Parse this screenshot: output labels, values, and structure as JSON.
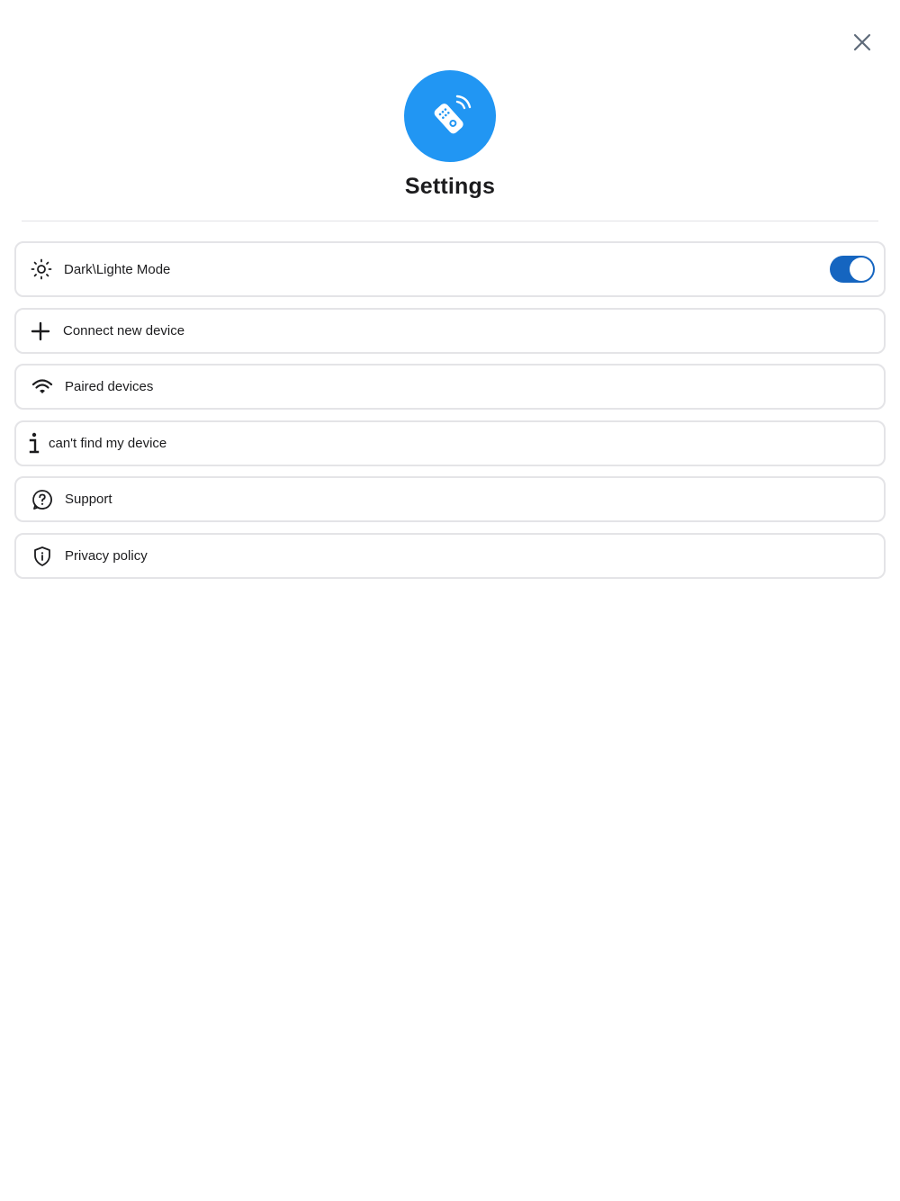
{
  "header": {
    "title": "Settings",
    "close_icon": "close-icon",
    "logo_icon": "remote-control-icon"
  },
  "colors": {
    "accent": "#2196f3",
    "toggle_on": "#1565c0",
    "icon": "#1c1c1e",
    "close_icon": "#5f6b7a",
    "border": "#e4e4e7"
  },
  "settings": {
    "items": [
      {
        "label": "Dark\\Lighte Mode",
        "icon": "sun-icon",
        "toggle": {
          "on": true
        }
      },
      {
        "label": "Connect new device",
        "icon": "plus-icon"
      },
      {
        "label": "Paired devices",
        "icon": "wifi-icon"
      },
      {
        "label": "can't find my device",
        "icon": "info-icon"
      },
      {
        "label": "Support",
        "icon": "help-circle-icon"
      },
      {
        "label": "Privacy policy",
        "icon": "shield-info-icon"
      }
    ]
  }
}
